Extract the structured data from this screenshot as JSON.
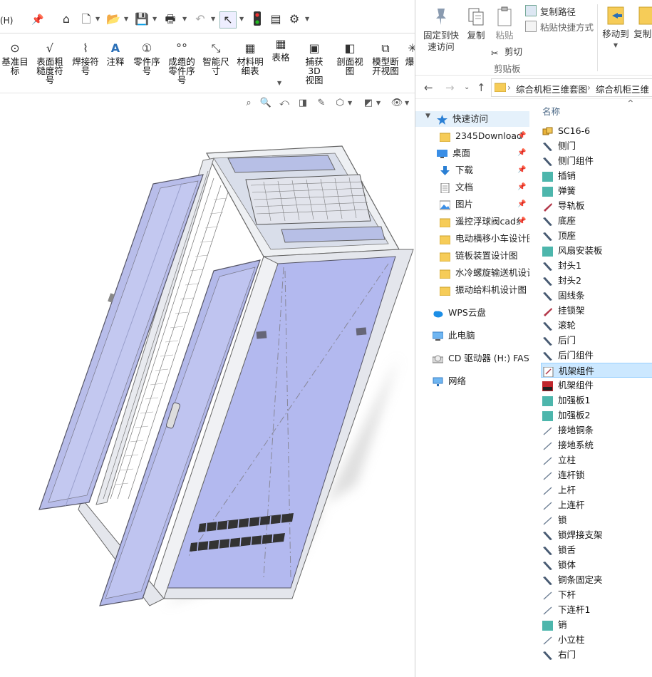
{
  "cad": {
    "menu_tail": "(H)",
    "ribbon_items": [
      {
        "icon": "smart-dimension-datum-icon",
        "label": "基准目\n标"
      },
      {
        "icon": "surface-finish-icon",
        "label": "表面粗\n糙度符\n号"
      },
      {
        "icon": "weld-symbol-icon",
        "label": "焊接符\n号"
      },
      {
        "icon": "note-icon",
        "label": "注释"
      },
      {
        "icon": "balloon-icon",
        "label": "零件序\n号"
      },
      {
        "icon": "auto-balloon-icon",
        "label": "成组的\n零件序\n号"
      },
      {
        "icon": "smart-dimension-icon",
        "label": "智能尺\n寸"
      },
      {
        "icon": "bom-icon",
        "label": "材料明\n细表"
      },
      {
        "icon": "table-icon",
        "label": "表格"
      },
      {
        "icon": "capture-3d-view-icon",
        "label": "捕获 3D\n视图"
      },
      {
        "icon": "section-view-icon",
        "label": "剖面视\n图"
      },
      {
        "icon": "broken-out-view-icon",
        "label": "模型断\n开视图"
      },
      {
        "icon": "exploded-view-icon",
        "label": "爆"
      }
    ]
  },
  "explorer": {
    "ribbon": {
      "pin_quick_access": "固定到快\n速访问",
      "copy": "复制",
      "paste": "粘贴",
      "cut": "剪切",
      "copy_path": "复制路径",
      "paste_shortcut": "粘贴快捷方式",
      "clipboard_group": "剪贴板",
      "move_to": "移动到",
      "copy_to": "复制到"
    },
    "breadcrumb": [
      "综合机柜三维套图",
      "综合机柜三维"
    ],
    "nav_tree": [
      {
        "label": "快速访问",
        "icon": "star",
        "pinned": false,
        "selected": true
      },
      {
        "label": "2345Download",
        "icon": "folder",
        "pinned": true
      },
      {
        "label": "桌面",
        "icon": "desktop",
        "pinned": true
      },
      {
        "label": "下载",
        "icon": "download",
        "pinned": true
      },
      {
        "label": "文档",
        "icon": "document",
        "pinned": true
      },
      {
        "label": "图片",
        "icon": "picture",
        "pinned": true
      },
      {
        "label": "遥控浮球阀cad纟",
        "icon": "folder",
        "pinned": true
      },
      {
        "label": "电动横移小车设计图",
        "icon": "folder",
        "pinned": false
      },
      {
        "label": "链板装置设计图",
        "icon": "folder",
        "pinned": false
      },
      {
        "label": "水冷螺旋输送机设计",
        "icon": "folder",
        "pinned": false
      },
      {
        "label": "振动给料机设计图",
        "icon": "folder",
        "pinned": false
      },
      {
        "label": "WPS云盘",
        "icon": "cloud",
        "pinned": false
      },
      {
        "label": "此电脑",
        "icon": "computer",
        "pinned": false
      },
      {
        "label": "CD 驱动器 (H:) FAST",
        "icon": "cd",
        "pinned": false
      },
      {
        "label": "网络",
        "icon": "network",
        "pinned": false
      }
    ],
    "column_header": "名称",
    "files": [
      {
        "name": "SC16-6",
        "icon": "assembly"
      },
      {
        "name": "侧门",
        "icon": "part"
      },
      {
        "name": "侧门组件",
        "icon": "part"
      },
      {
        "name": "插销",
        "icon": "part-teal"
      },
      {
        "name": "弹簧",
        "icon": "part-teal"
      },
      {
        "name": "导轨板",
        "icon": "part-red"
      },
      {
        "name": "底座",
        "icon": "part"
      },
      {
        "name": "顶座",
        "icon": "part"
      },
      {
        "name": "风扇安装板",
        "icon": "part-teal"
      },
      {
        "name": "封头1",
        "icon": "part"
      },
      {
        "name": "封头2",
        "icon": "part"
      },
      {
        "name": "固线条",
        "icon": "part"
      },
      {
        "name": "挂锁架",
        "icon": "part-red"
      },
      {
        "name": "滚轮",
        "icon": "part"
      },
      {
        "name": "后门",
        "icon": "part"
      },
      {
        "name": "后门组件",
        "icon": "part"
      },
      {
        "name": "机架组件",
        "icon": "drawing",
        "selected": true
      },
      {
        "name": "机架组件",
        "icon": "solidworks-2020"
      },
      {
        "name": "加强板1",
        "icon": "part-teal"
      },
      {
        "name": "加强板2",
        "icon": "part-teal"
      },
      {
        "name": "接地铜条",
        "icon": "part-thin"
      },
      {
        "name": "接地系统",
        "icon": "part-thin"
      },
      {
        "name": "立柱",
        "icon": "part-thin"
      },
      {
        "name": "连杆锁",
        "icon": "part-thin"
      },
      {
        "name": "上杆",
        "icon": "part-thin"
      },
      {
        "name": "上连杆",
        "icon": "part-thin"
      },
      {
        "name": "锁",
        "icon": "part-thin"
      },
      {
        "name": "锁焊接支架",
        "icon": "part"
      },
      {
        "name": "锁舌",
        "icon": "part"
      },
      {
        "name": "锁体",
        "icon": "part"
      },
      {
        "name": "铜条固定夹",
        "icon": "part"
      },
      {
        "name": "下杆",
        "icon": "part-thin"
      },
      {
        "name": "下连杆1",
        "icon": "part-thin"
      },
      {
        "name": "销",
        "icon": "part-teal"
      },
      {
        "name": "小立柱",
        "icon": "part-thin"
      },
      {
        "name": "右门",
        "icon": "part"
      }
    ]
  }
}
